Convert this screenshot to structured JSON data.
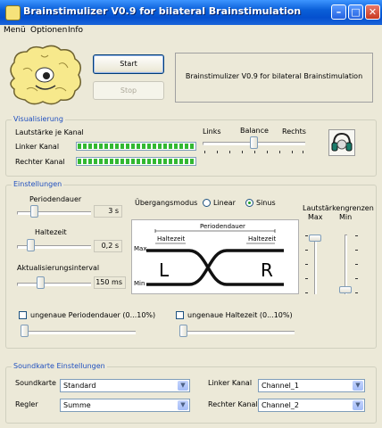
{
  "window": {
    "title": "Brainstimulizer V0.9 for bilateral Brainstimulation"
  },
  "menu": [
    "Menü",
    "Optionen",
    "Info"
  ],
  "controls": {
    "start_label": "Start",
    "stop_label": "Stop",
    "info_text": "Brainstimulizer V0.9 for bilateral Brainstimulation"
  },
  "visualisierung": {
    "title": "Visualisierung",
    "level_label": "Lautstärke je Kanal",
    "left_label": "Linker Kanal",
    "right_label": "Rechter Kanal",
    "left_level": 1.0,
    "right_level": 1.0,
    "balance": {
      "label": "Balance",
      "left": "Links",
      "right": "Rechts",
      "value": 0.5
    }
  },
  "einstellungen": {
    "title": "Einstellungen",
    "periodendauer": {
      "label": "Periodendauer",
      "value": "3 s",
      "position": 0.2
    },
    "haltezeit": {
      "label": "Haltezeit",
      "value": "0,2 s",
      "position": 0.15
    },
    "aktualisierung": {
      "label": "Aktualisierungsinterval",
      "value": "150 ms",
      "position": 0.3
    },
    "uebergang": {
      "label": "Übergangsmodus",
      "options": [
        "Linear",
        "Sinus"
      ],
      "selected": "Sinus"
    },
    "diagram": {
      "periodendauer": "Periodendauer",
      "haltezeit_left": "Haltezeit",
      "haltezeit_right": "Haltezeit",
      "max": "Max",
      "min": "Min",
      "left": "L",
      "right": "R"
    },
    "lautstaerkegrenzen": {
      "label": "Lautstärkengrenzen",
      "max_label": "Max",
      "min_label": "Min",
      "max_value": 1.0,
      "min_value": 0.0
    },
    "ungenau_periode": {
      "label": "ungenaue Periodendauer (0...10%)",
      "checked": false,
      "position": 0.0
    },
    "ungenau_halte": {
      "label": "ungenaue Haltezeit (0...10%)",
      "checked": false,
      "position": 0.0
    }
  },
  "soundkarte": {
    "title": "Soundkarte Einstellungen",
    "soundkarte_label": "Soundkarte",
    "soundkarte_value": "Standard",
    "regler_label": "Regler",
    "regler_value": "Summe",
    "linker_label": "Linker Kanal",
    "linker_value": "Channel_1",
    "rechter_label": "Rechter Kanal",
    "rechter_value": "Channel_2"
  },
  "colors": {
    "titlebar": "#0a5fd8",
    "group_title": "#1f4fbf",
    "meter_green": "#32b832",
    "window_bg": "#ece9d8"
  }
}
